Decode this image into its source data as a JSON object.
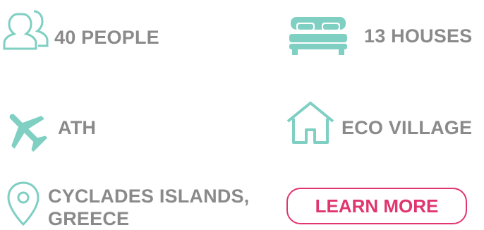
{
  "colors": {
    "icon": "#7fcfc3",
    "text": "#8a8a8a",
    "accent": "#e0356f"
  },
  "features": {
    "people": {
      "icon": "people-icon",
      "label": "40 PEOPLE"
    },
    "houses": {
      "icon": "bed-icon",
      "label": "13 HOUSES"
    },
    "airport": {
      "icon": "airplane-icon",
      "label": "ATH"
    },
    "village": {
      "icon": "house-icon",
      "label": "ECO VILLAGE"
    },
    "location": {
      "icon": "location-pin-icon",
      "label": "CYCLADES ISLANDS, GREECE"
    }
  },
  "cta": {
    "label": "LEARN MORE"
  }
}
